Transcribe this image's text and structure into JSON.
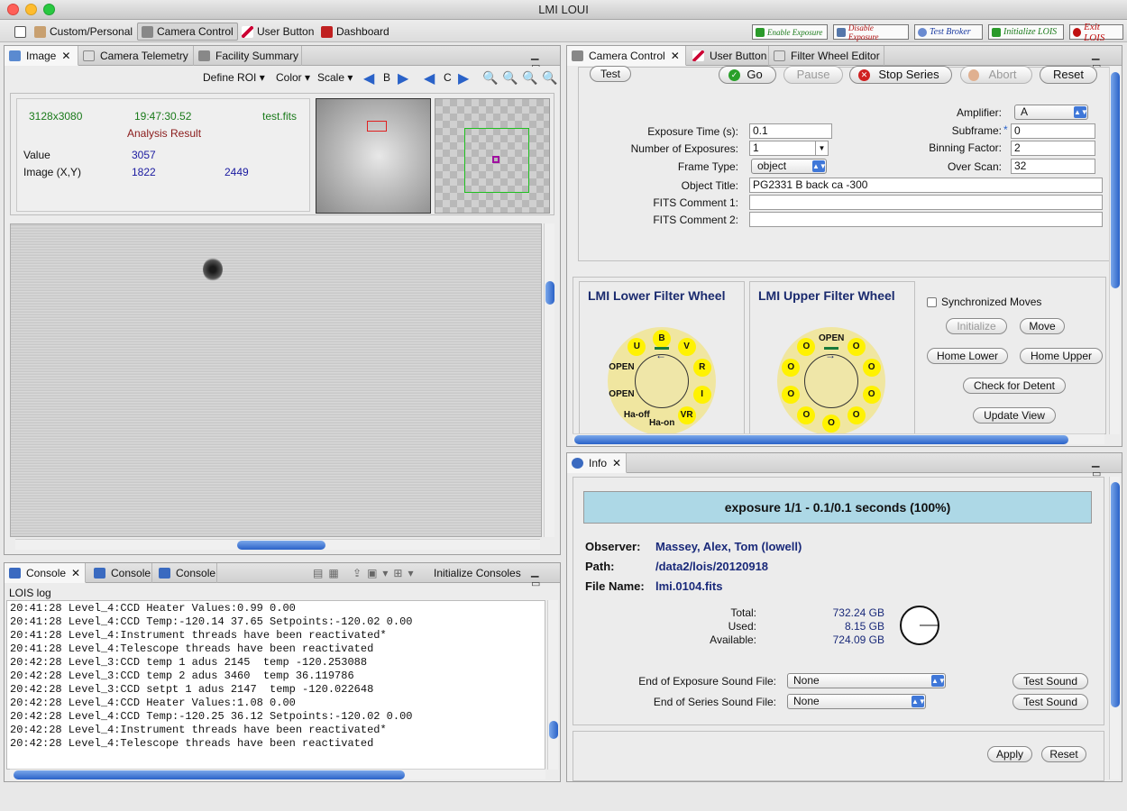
{
  "app": {
    "title": "LMI LOUI"
  },
  "perspectives": {
    "items": [
      {
        "label": "Custom/Personal"
      },
      {
        "label": "Camera Control"
      },
      {
        "label": "User Button"
      },
      {
        "label": "Dashboard"
      }
    ]
  },
  "actions": {
    "enable_exposure": "Enable Exposure",
    "disable_exposure": "Disable Exposure",
    "test_broker": "Test Broker",
    "initialize_lois": "Initialize LOIS",
    "exit_lois": "Exit LOIS"
  },
  "image_panel": {
    "tabs": [
      {
        "label": "Image"
      },
      {
        "label": "Camera Telemetry"
      },
      {
        "label": "Facility Summary"
      }
    ],
    "toolbar": {
      "define_roi": "Define ROI",
      "color": "Color",
      "scale": "Scale",
      "b": "B",
      "c": "C"
    },
    "analysis": {
      "dims": "3128x3080",
      "time": "19:47:30.52",
      "file": "test.fits",
      "heading": "Analysis Result",
      "value_label": "Value",
      "value": "3057",
      "xy_label": "Image (X,Y)",
      "x": "1822",
      "y": "2449"
    }
  },
  "console_panel": {
    "tabs": [
      {
        "label": "Console"
      },
      {
        "label": "Console"
      },
      {
        "label": "Console"
      }
    ],
    "init_label": "Initialize Consoles",
    "log_title": "LOIS log",
    "lines": [
      "20:41:28 Level_4:CCD Heater Values:0.99 0.00",
      "20:41:28 Level_4:CCD Temp:-120.14 37.65 Setpoints:-120.02 0.00",
      "20:41:28 Level_4:Instrument threads have been reactivated*",
      "20:41:28 Level_4:Telescope threads have been reactivated",
      "20:42:28 Level_3:CCD temp 1 adus 2145  temp -120.253088",
      "20:42:28 Level_3:CCD temp 2 adus 3460  temp 36.119786",
      "20:42:28 Level_3:CCD setpt 1 adus 2147  temp -120.022648",
      "20:42:28 Level_4:CCD Heater Values:1.08 0.00",
      "20:42:28 Level_4:CCD Temp:-120.25 36.12 Setpoints:-120.02 0.00",
      "20:42:28 Level_4:Instrument threads have been reactivated*",
      "20:42:28 Level_4:Telescope threads have been reactivated"
    ]
  },
  "camera_panel": {
    "tabs": [
      {
        "label": "Camera Control"
      },
      {
        "label": "User Button"
      },
      {
        "label": "Filter Wheel Editor"
      }
    ],
    "buttons": {
      "test": "Test",
      "go": "Go",
      "pause": "Pause",
      "stop": "Stop Series",
      "abort": "Abort",
      "reset": "Reset"
    },
    "form": {
      "exposure_time_label": "Exposure Time (s):",
      "exposure_time": "0.1",
      "num_exposures_label": "Number of Exposures:",
      "num_exposures": "1",
      "frame_type_label": "Frame Type:",
      "frame_type": "object",
      "object_title_label": "Object Title:",
      "object_title": "PG2331 B back ca -300",
      "fits1_label": "FITS Comment 1:",
      "fits1": "",
      "fits2_label": "FITS Comment 2:",
      "fits2": "",
      "amplifier_label": "Amplifier:",
      "amplifier": "A",
      "subframe_label": "Subframe:",
      "subframe_star": "*",
      "subframe": "0",
      "binning_label": "Binning Factor:",
      "binning": "2",
      "overscan_label": "Over Scan:",
      "overscan": "32"
    },
    "filter": {
      "lower_title": "LMI Lower Filter Wheel",
      "upper_title": "LMI Upper Filter Wheel",
      "lower_positions": [
        "B",
        "V",
        "R",
        "I",
        "VR",
        "Ha-on",
        "Ha-off",
        "OPEN",
        "OPEN",
        "U"
      ],
      "upper_positions": [
        "OPEN",
        "O",
        "O",
        "O",
        "O",
        "O",
        "O",
        "O",
        "O",
        "O"
      ],
      "sync_label": "Synchronized Moves",
      "initialize": "Initialize",
      "move": "Move",
      "home_lower": "Home Lower",
      "home_upper": "Home Upper",
      "check_detent": "Check for Detent",
      "update_view": "Update View"
    }
  },
  "info_panel": {
    "tab": "Info",
    "progress": {
      "text": "exposure 1/1 - 0.1/0.1 seconds (100%)",
      "fraction": 1.0
    },
    "observer_label": "Observer:",
    "observer": "Massey, Alex, Tom (lowell)",
    "path_label": "Path:",
    "path": "/data2/lois/20120918",
    "file_label": "File Name:",
    "file": "lmi.0104.fits",
    "disk": {
      "total_label": "Total:",
      "total": "732.24 GB",
      "used_label": "Used:",
      "used": "8.15 GB",
      "available_label": "Available:",
      "available": "724.09 GB"
    },
    "eoe_sound_label": "End of Exposure Sound File:",
    "eoe_sound": "None",
    "eos_sound_label": "End of Series Sound File:",
    "eos_sound": "None",
    "test_sound": "Test Sound",
    "apply": "Apply",
    "reset": "Reset"
  },
  "colors": {
    "accent": "#2a62c8",
    "progress_bg": "#add8e6",
    "analysis_green": "#1a7a1a",
    "analysis_red": "#8a1a1a",
    "value_blue": "#1a1aa0"
  }
}
